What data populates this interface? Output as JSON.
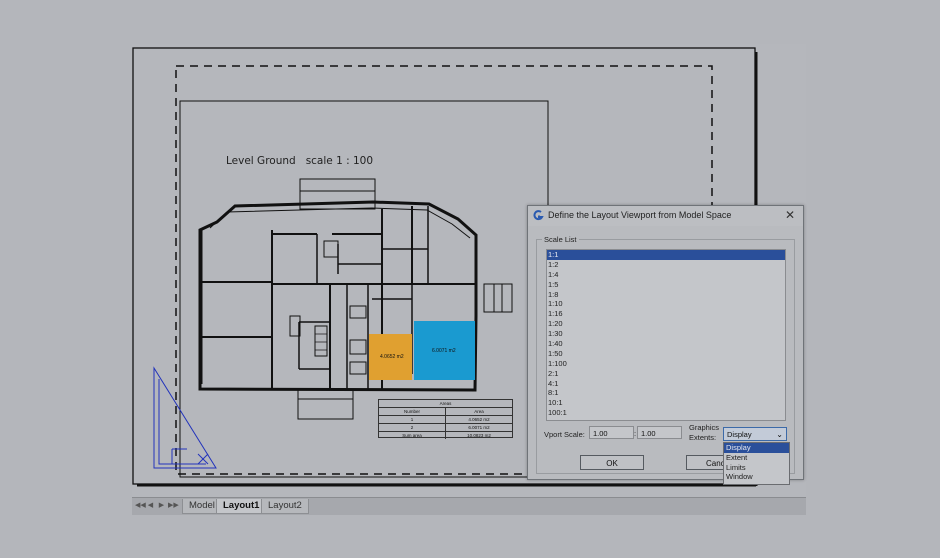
{
  "drawing": {
    "title": "Level Ground   scale 1 : 100",
    "areas": [
      {
        "label": "4.0652 m2"
      },
      {
        "label": "6.0071 m2"
      }
    ],
    "table": {
      "header": "Areas",
      "columns": [
        "Number",
        "Area"
      ],
      "rows": [
        [
          "1",
          "4.0652 m2"
        ],
        [
          "2",
          "6.0071 m2"
        ],
        [
          "Sum area",
          "10.0823 m2"
        ]
      ]
    },
    "colors": {
      "area1": "#e0a030",
      "area2": "#1a9ad0"
    }
  },
  "tabs": {
    "nav": [
      "◀◀",
      "◀",
      "▶",
      "▶▶"
    ],
    "items": [
      "Model",
      "Layout1",
      "Layout2"
    ],
    "active": "Layout1"
  },
  "dialog": {
    "title": "Define the Layout Viewport from Model Space",
    "close": "✕",
    "scale_list_label": "Scale List",
    "scales": [
      "1:1",
      "1:2",
      "1:4",
      "1:5",
      "1:8",
      "1:10",
      "1:16",
      "1:20",
      "1:30",
      "1:40",
      "1:50",
      "1:100",
      "2:1",
      "4:1",
      "8:1",
      "10:1",
      "100:1"
    ],
    "selected_scale": "1:1",
    "vport_scale_label": "Vport Scale:",
    "vport_scale_a": "1.00",
    "vport_scale_sep": ":",
    "vport_scale_b": "1.00",
    "graphics_extents_label_1": "Graphics",
    "graphics_extents_label_2": "Extents:",
    "extents_value": "Display",
    "extents_options": [
      "Display",
      "Extent",
      "Limits",
      "Window"
    ],
    "ok_label": "OK",
    "cancel_label": "Cancel",
    "accent": "#2a4f9a"
  }
}
